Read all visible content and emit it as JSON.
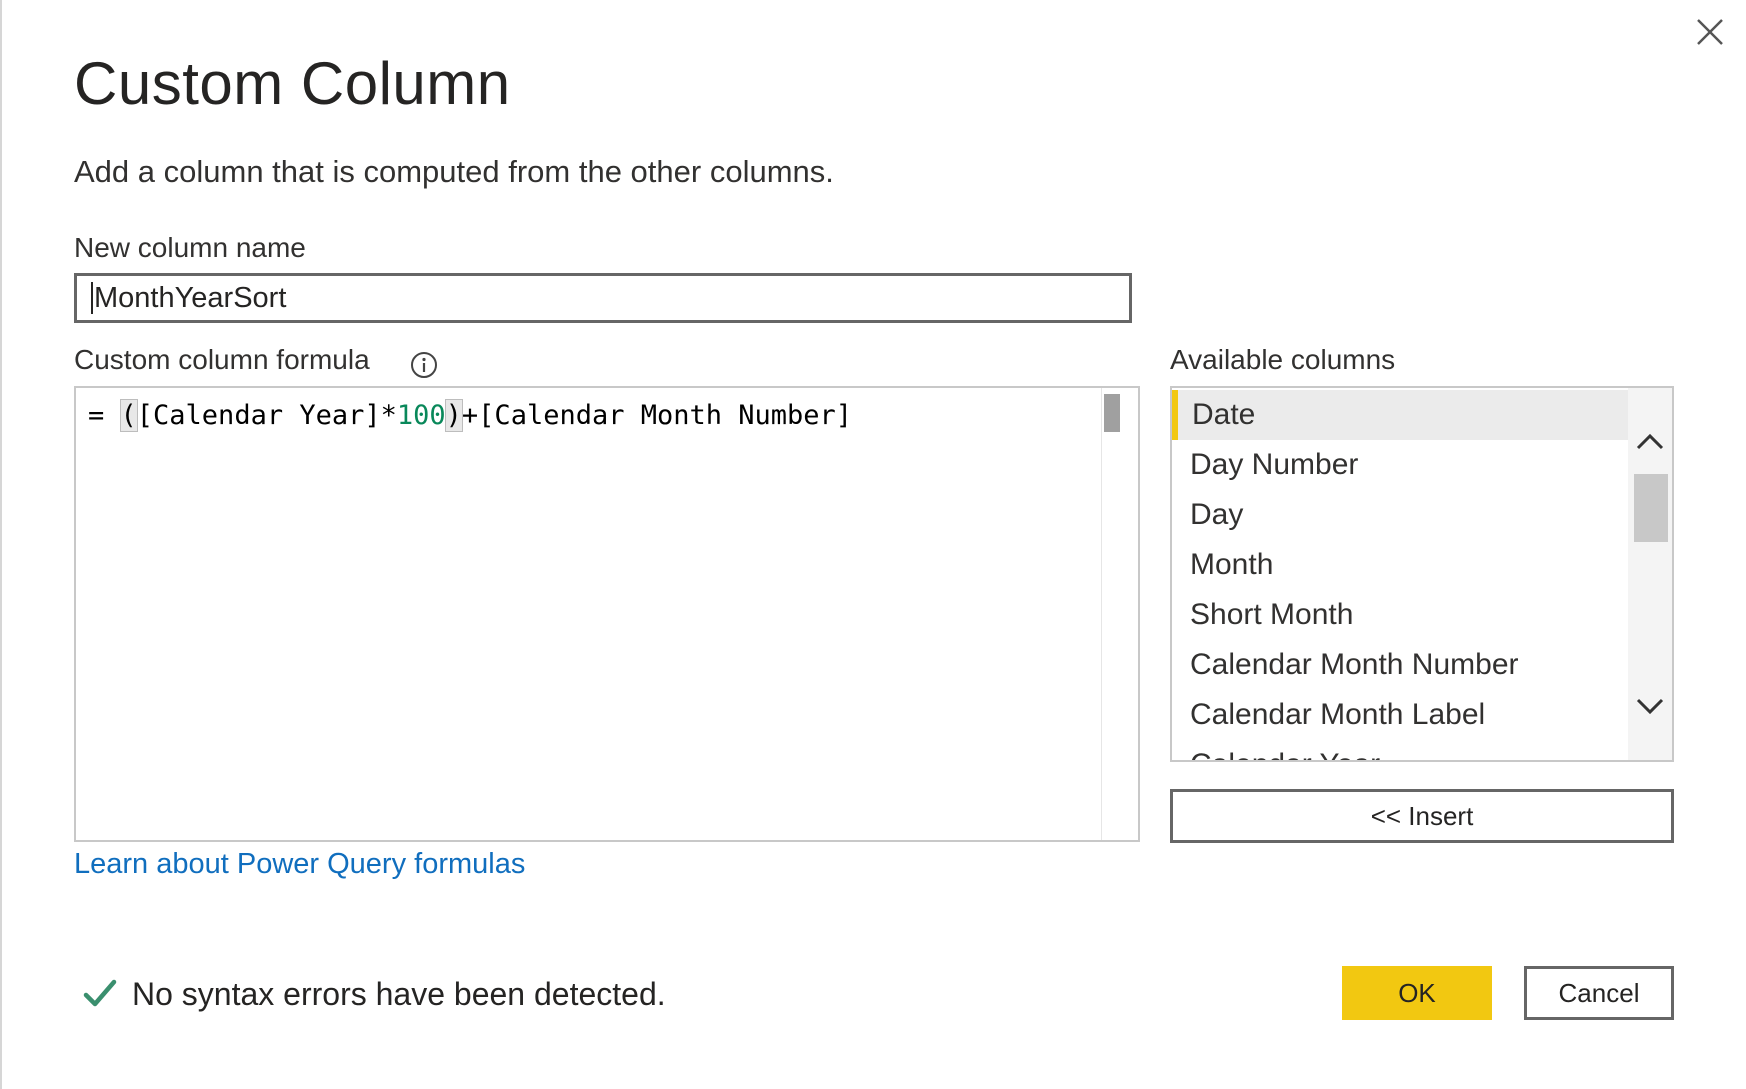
{
  "dialog": {
    "title": "Custom Column",
    "subtitle": "Add a column that is computed from the other columns."
  },
  "new_column": {
    "label": "New column name",
    "value": "MonthYearSort"
  },
  "formula": {
    "label": "Custom column formula",
    "info_icon": "info-icon",
    "prefix": "= ",
    "open_paren": "(",
    "part1": "[Calendar Year]*",
    "number": "100",
    "close_paren": ")",
    "part2": "+[Calendar Month Number]"
  },
  "available_columns": {
    "label": "Available columns",
    "items": [
      {
        "label": "Date",
        "selected": true
      },
      {
        "label": "Day Number"
      },
      {
        "label": "Day"
      },
      {
        "label": "Month"
      },
      {
        "label": "Short Month"
      },
      {
        "label": "Calendar Month Number"
      },
      {
        "label": "Calendar Month Label"
      },
      {
        "label": "Calendar Year"
      }
    ],
    "insert_label": "<< Insert"
  },
  "learn_link": "Learn about Power Query formulas",
  "status": {
    "icon": "check-icon",
    "text": "No syntax errors have been detected."
  },
  "buttons": {
    "ok": "OK",
    "cancel": "Cancel"
  },
  "colors": {
    "accent": "#f2c811",
    "link": "#106ebe",
    "success": "#3a8f6e",
    "number": "#09885a"
  }
}
